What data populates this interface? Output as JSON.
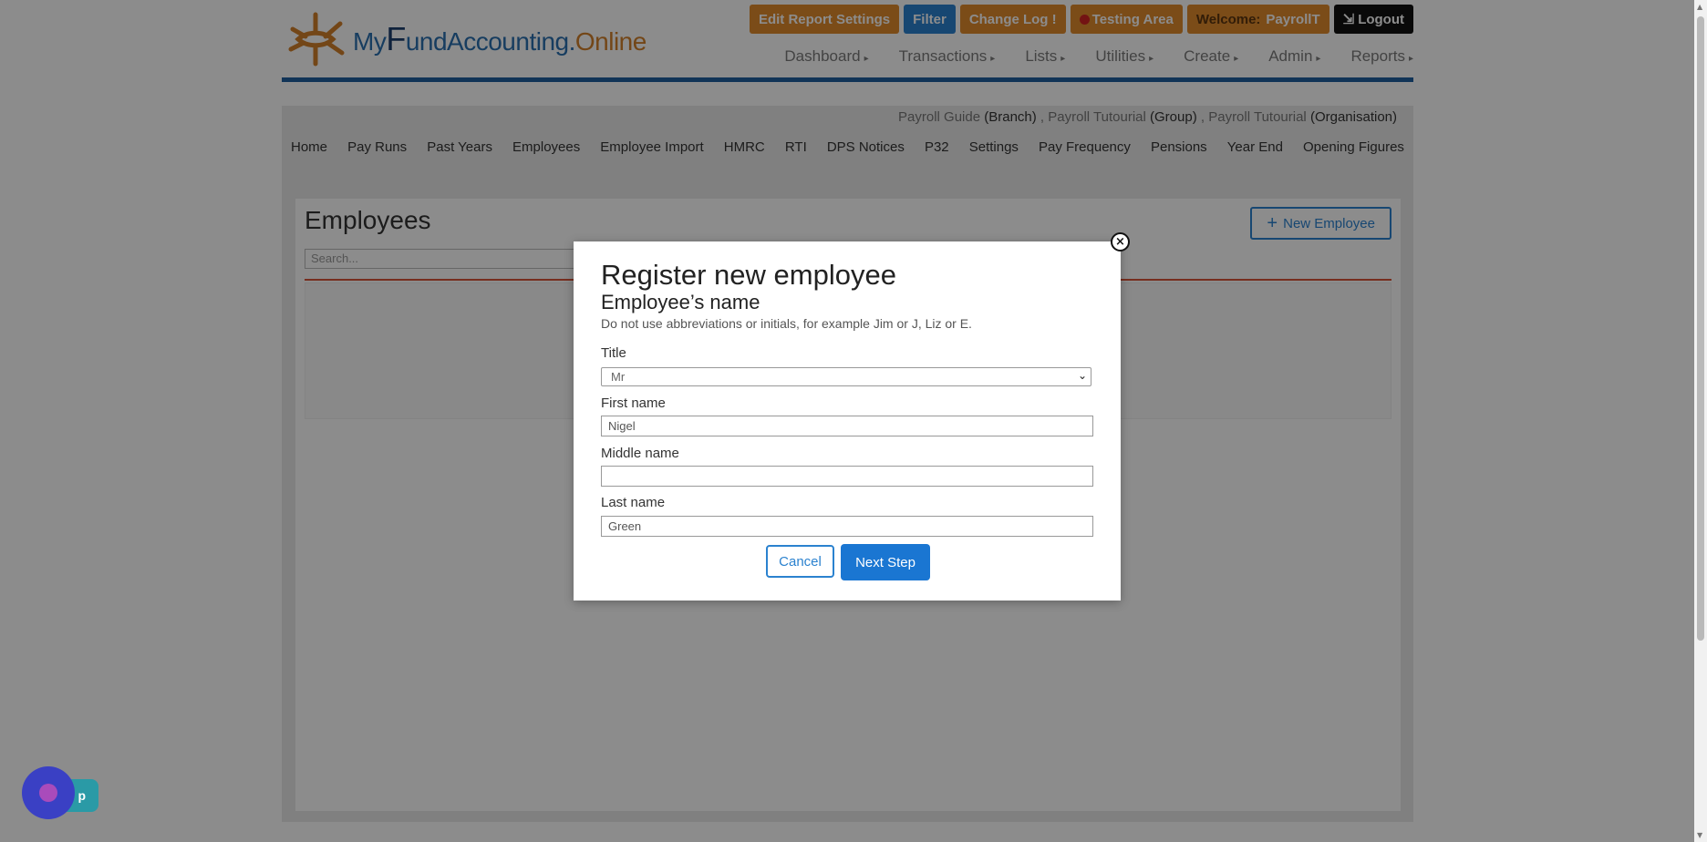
{
  "header": {
    "logo": {
      "my": "My",
      "f": "F",
      "rest": "undAccounting",
      "dot": ".",
      "online": "Online"
    },
    "buttons": {
      "edit_report_settings": "Edit Report Settings",
      "filter": "Filter",
      "change_log": "Change Log",
      "change_log_mark": "!",
      "testing_area": "Testing Area",
      "welcome_prefix": "Welcome:",
      "welcome_user": "PayrollT",
      "logout_icon": "⇲",
      "logout": "Logout"
    },
    "nav": [
      {
        "label": "Dashboard"
      },
      {
        "label": "Transactions"
      },
      {
        "label": "Lists"
      },
      {
        "label": "Utilities"
      },
      {
        "label": "Create"
      },
      {
        "label": "Admin"
      },
      {
        "label": "Reports"
      }
    ],
    "nav_caret": "▸",
    "colors": {
      "orange": "#e08a2c",
      "blue": "#2b82cf",
      "rule": "#1f5f9e"
    }
  },
  "context": {
    "branch": "Payroll Guide",
    "branch_tag": "(Branch)",
    "sep1": " ,",
    "group": "Payroll Tutourial",
    "group_tag": "(Group)",
    "sep2": " ,",
    "organisation": "Payroll Tutourial",
    "organisation_tag": "(Organisation)"
  },
  "subnav": [
    "Home",
    "Pay Runs",
    "Past Years",
    "Employees",
    "Employee Import",
    "HMRC",
    "RTI",
    "DPS Notices",
    "P32",
    "Settings",
    "Pay Frequency",
    "Pensions",
    "Year End",
    "Opening Figures"
  ],
  "employees_page": {
    "title": "Employees",
    "new_employee": "New Employee",
    "new_employee_icon": "+",
    "search_placeholder": "Search..."
  },
  "modal": {
    "close_icon": "×",
    "title": "Register new employee",
    "subtitle": "Employee’s name",
    "hint": "Do not use abbreviations or initials, for example Jim or J, Liz or E.",
    "title_label": "Title",
    "title_value": "Mr",
    "first_name_label": "First name",
    "first_name_value": "Nigel",
    "middle_name_label": "Middle name",
    "middle_name_value": "",
    "last_name_label": "Last name",
    "last_name_value": "Green",
    "cancel": "Cancel",
    "next_step": "Next Step"
  },
  "help_widget": {
    "tab_label": "p"
  }
}
